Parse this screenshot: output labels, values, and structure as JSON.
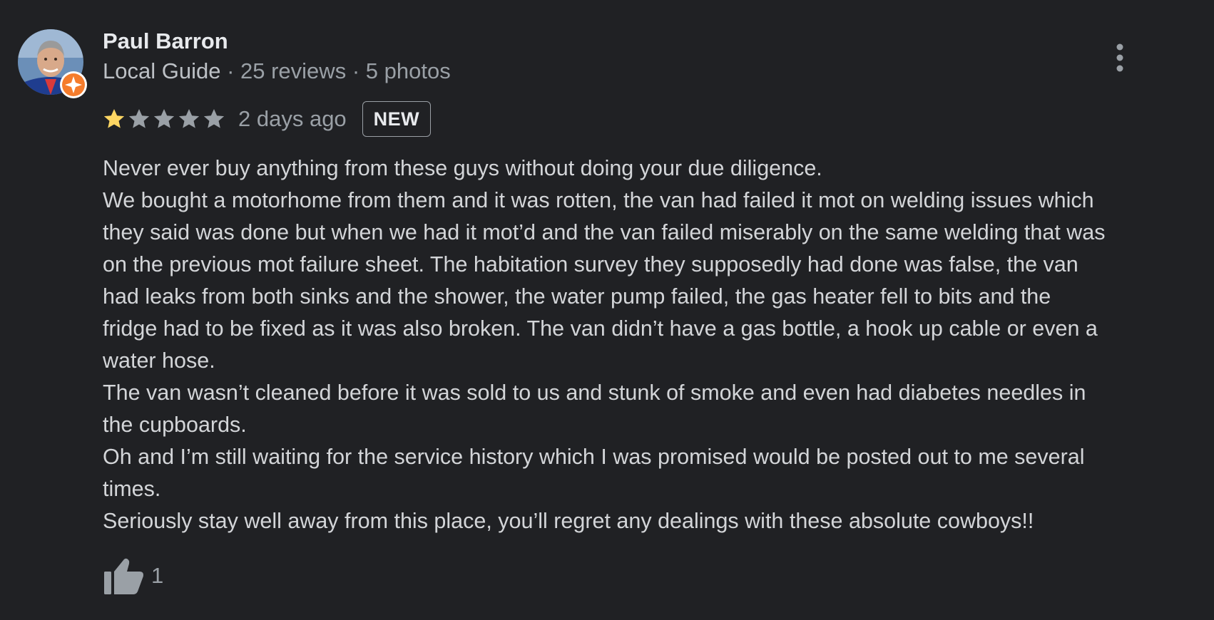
{
  "review": {
    "author": "Paul Barron",
    "author_badge": "Local Guide",
    "separator": " · ",
    "reviews_count": "25 reviews",
    "photos_count": "5 photos",
    "rating": 1,
    "max_rating": 5,
    "date": "2 days ago",
    "badge": "NEW",
    "text_lines": [
      "Never ever buy anything from these guys without doing your due diligence.",
      "We bought a motorhome from them and it was rotten, the van had failed it mot on welding issues which",
      "they said was done but when we had it mot’d and the van failed miserably on the same welding that was",
      "on the previous mot failure sheet. The habitation survey they supposedly had done was false, the van",
      "had leaks from both sinks and the shower, the water pump failed, the gas heater fell to bits and the",
      "fridge had to be fixed as it was also broken. The van didn’t have a gas bottle, a hook up cable or even a",
      "water hose.",
      "The van wasn’t cleaned before it was sold to us and stunk of smoke and even had diabetes needles in",
      "the cupboards.",
      "Oh and I’m still waiting for the service history which I was promised would be posted out to me several",
      "times.",
      "Seriously stay well away from this place, you’ll regret any dealings with these absolute cowboys!!"
    ],
    "likes": "1"
  },
  "icons": {
    "avatar": "profile-photo",
    "local_guide_badge": "local-guide-badge-icon",
    "more": "more-vert-icon",
    "star": "star-icon",
    "like": "thumb-up-icon"
  },
  "colors": {
    "background": "#202124",
    "text": "#d3d5d8",
    "secondary_text": "#9aa0a6",
    "star_filled": "#fdd663",
    "star_empty": "#9aa0a6",
    "local_guide_orange": "#f57c2c"
  }
}
